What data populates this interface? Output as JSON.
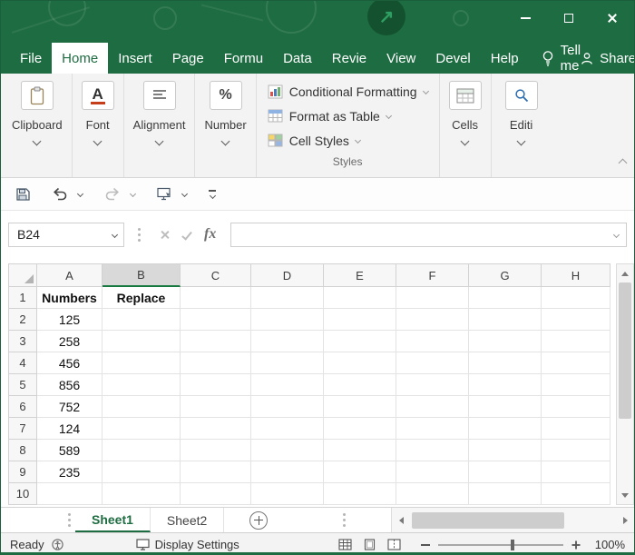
{
  "menu": {
    "tabs": [
      {
        "label": "File",
        "active": false
      },
      {
        "label": "Home",
        "active": true
      },
      {
        "label": "Insert",
        "active": false
      },
      {
        "label": "Page",
        "active": false
      },
      {
        "label": "Formu",
        "active": false
      },
      {
        "label": "Data",
        "active": false
      },
      {
        "label": "Revie",
        "active": false
      },
      {
        "label": "View",
        "active": false
      },
      {
        "label": "Devel",
        "active": false
      },
      {
        "label": "Help",
        "active": false
      }
    ],
    "tell_me": "Tell me",
    "share": "Share"
  },
  "ribbon": {
    "groups": [
      {
        "label": "Clipboard"
      },
      {
        "label": "Font"
      },
      {
        "label": "Alignment"
      },
      {
        "label": "Number"
      }
    ],
    "styles_group": {
      "items": [
        "Conditional Formatting",
        "Format as Table",
        "Cell Styles"
      ],
      "label": "Styles"
    },
    "cells_label": "Cells",
    "editing_label": "Editi"
  },
  "formula_bar": {
    "name_box": "B24",
    "fx_label": "fx",
    "formula_value": ""
  },
  "grid": {
    "columns": [
      "A",
      "B",
      "C",
      "D",
      "E",
      "F",
      "G",
      "H"
    ],
    "selected_column": "B",
    "rows": [
      {
        "n": "1",
        "bold": true,
        "cells": {
          "A": "Numbers",
          "B": "Replace"
        }
      },
      {
        "n": "2",
        "cells": {
          "A": "125"
        }
      },
      {
        "n": "3",
        "cells": {
          "A": "258"
        }
      },
      {
        "n": "4",
        "cells": {
          "A": "456"
        }
      },
      {
        "n": "5",
        "cells": {
          "A": "856"
        }
      },
      {
        "n": "6",
        "cells": {
          "A": "752"
        }
      },
      {
        "n": "7",
        "cells": {
          "A": "124"
        }
      },
      {
        "n": "8",
        "cells": {
          "A": "589"
        }
      },
      {
        "n": "9",
        "cells": {
          "A": "235"
        }
      },
      {
        "n": "10",
        "cells": {}
      }
    ]
  },
  "sheets": {
    "tabs": [
      {
        "label": "Sheet1",
        "active": true
      },
      {
        "label": "Sheet2",
        "active": false
      }
    ]
  },
  "status_bar": {
    "mode": "Ready",
    "display_settings": "Display Settings",
    "zoom_level": "100%"
  },
  "colors": {
    "excel_green": "#1E6C41",
    "accent_green": "#107C41"
  }
}
